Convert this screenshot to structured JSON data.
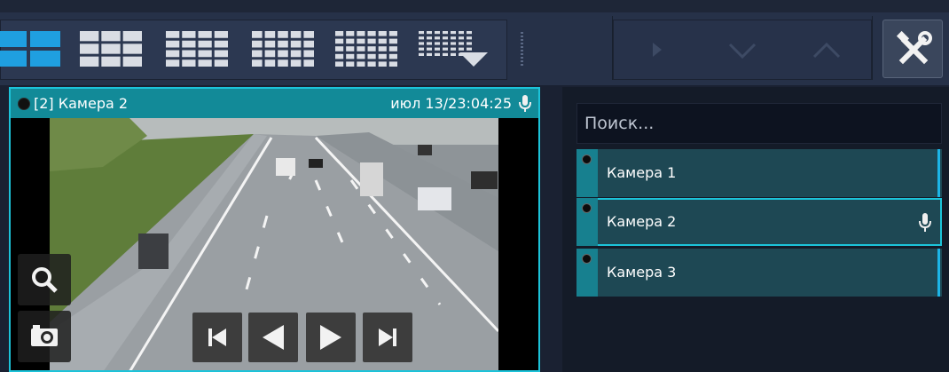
{
  "toolbar": {
    "layouts": [
      "layout-1",
      "layout-2",
      "layout-3",
      "layout-4",
      "layout-5",
      "layout-more"
    ],
    "active_layout": 0,
    "accent": "#1f9fe0"
  },
  "camera_view": {
    "title": "[2] Камера 2",
    "timestamp": "июл 13/23:04:25",
    "border_color": "#1cc3d9",
    "header_color": "#128a98"
  },
  "search": {
    "placeholder": "Поиск..."
  },
  "camera_list": [
    {
      "label": "Камера 1",
      "selected": false,
      "mic": false
    },
    {
      "label": "Камера 2",
      "selected": true,
      "mic": true
    },
    {
      "label": "Камера 3",
      "selected": false,
      "mic": false
    }
  ]
}
